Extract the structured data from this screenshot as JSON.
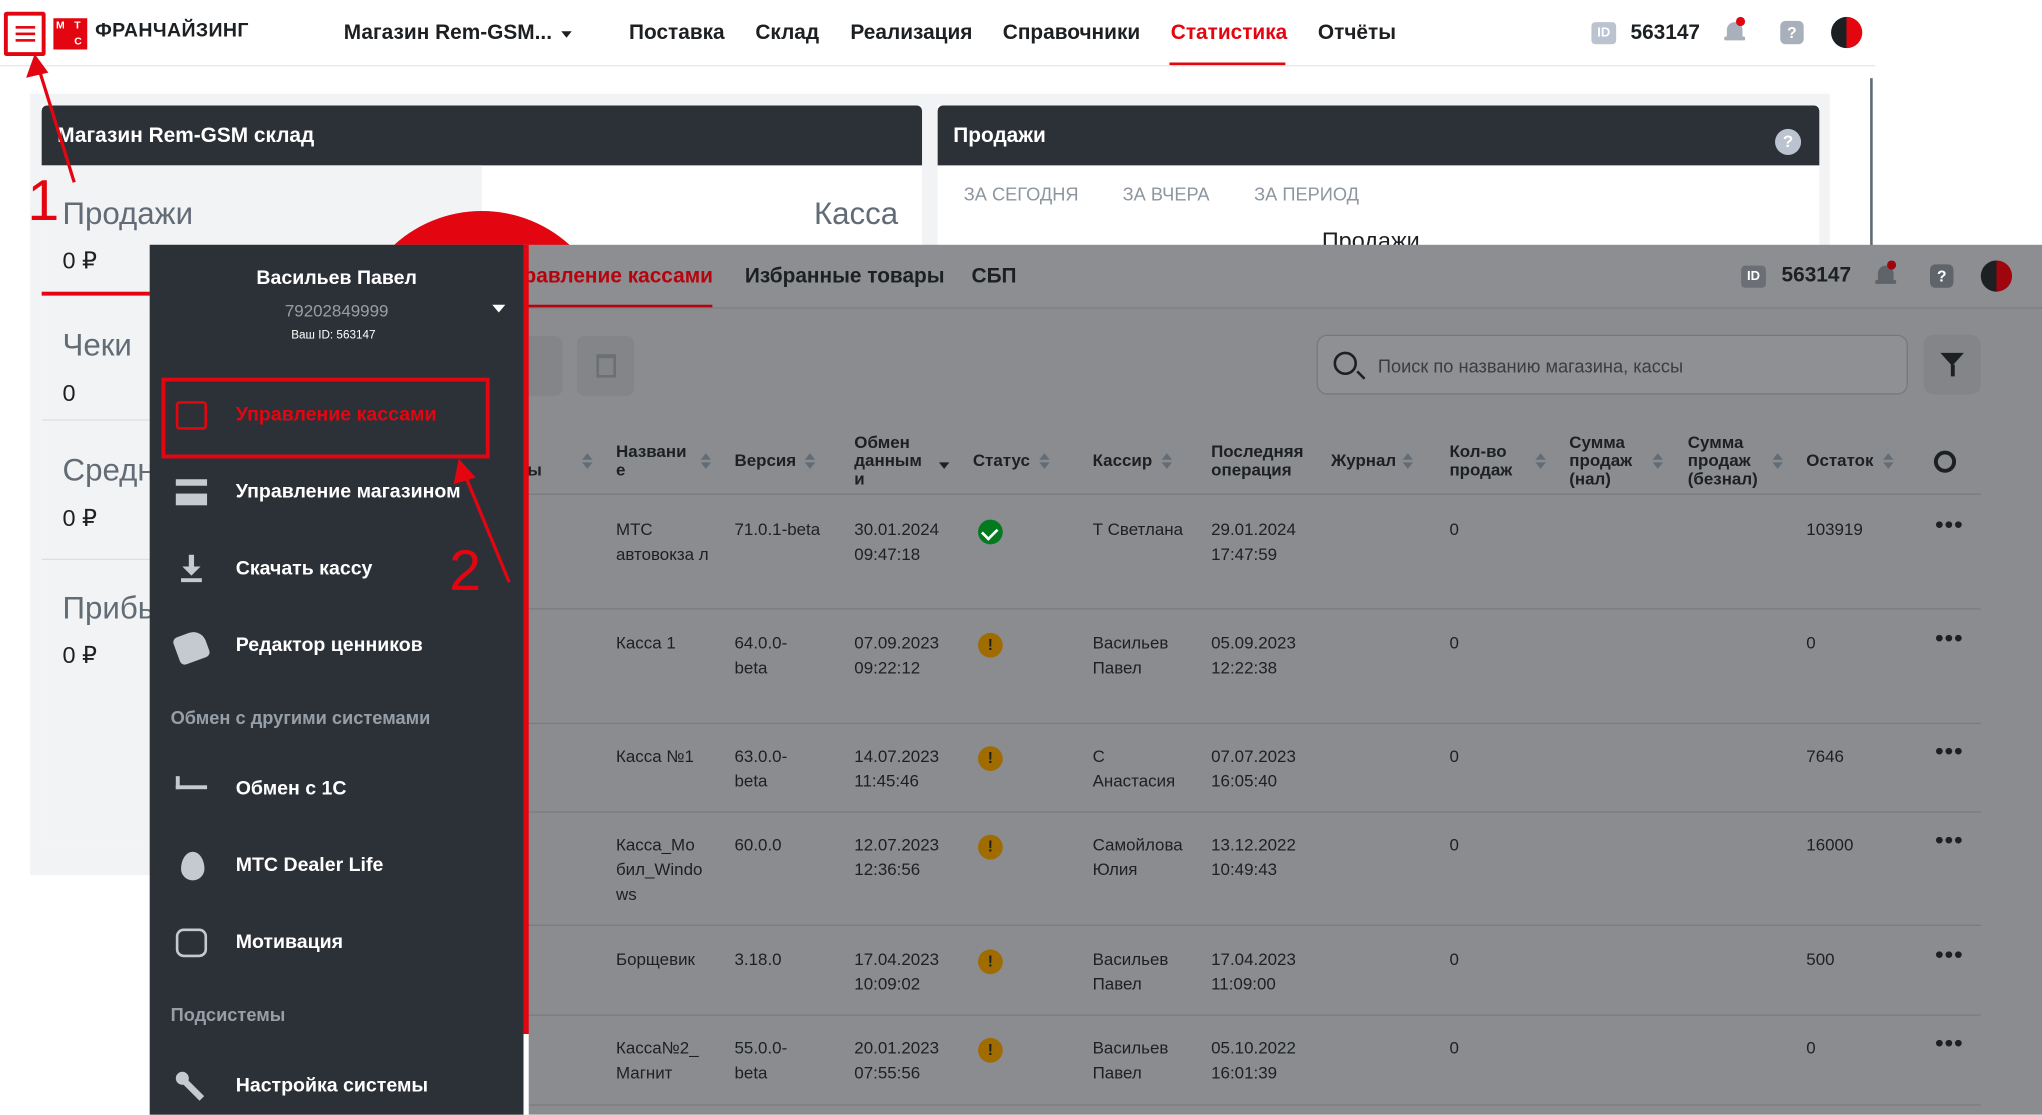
{
  "topbar": {
    "logo_letters": [
      "М",
      "Т",
      "С"
    ],
    "brand": "ФРАНЧАЙЗИНГ",
    "store": "Магазин Rem-GSM...",
    "nav": [
      "Поставка",
      "Склад",
      "Реализация",
      "Справочники",
      "Статистика",
      "Отчёты"
    ],
    "active_nav": "Статистика",
    "id_badge": "ID",
    "user_id": "563147"
  },
  "dashboard": {
    "store_card_title": "Магазин Rem-GSM склад",
    "stats": [
      {
        "label": "Продажи",
        "value": "0 ₽"
      },
      {
        "label": "Чеки",
        "value": "0"
      },
      {
        "label": "Средн",
        "value": "0 ₽"
      },
      {
        "label": "Прибь",
        "value": "0 ₽"
      }
    ],
    "kassa_label": "Касса",
    "sales_card_title": "Продажи",
    "help_glyph": "?",
    "periods": [
      "ЗА СЕГОДНЯ",
      "ЗА ВЧЕРА",
      "ЗА ПЕРИОД"
    ],
    "sales_subtitle": "Продажи"
  },
  "cashbox_window": {
    "tabs": [
      "равление кассами",
      "Избранные товары",
      "СБП"
    ],
    "active_tab": "равление кассами",
    "id_badge": "ID",
    "user_id": "563147",
    "search_placeholder": "Поиск по названию магазина, кассы",
    "columns": {
      "c0": "ы",
      "name": "Названи е",
      "version": "Версия",
      "exchange": "Обмен данным и",
      "status": "Статус",
      "cashier": "Кассир",
      "last_op": "Последняя операция",
      "journal": "Журнал",
      "sales_count": "Кол-во продаж",
      "sum_cash": "Сумма продаж (нал)",
      "sum_noncash": "Сумма продаж (безнал)",
      "balance": "Остаток"
    },
    "rows": [
      {
        "name": "МТС автовокза л",
        "version": "71.0.1-beta",
        "exchange": "30.01.2024 09:47:18",
        "status": "ok",
        "cashier": "Т Светлана",
        "last_op": "29.01.2024 17:47:59",
        "sales_count": "0",
        "balance": "103919"
      },
      {
        "name": "Касса 1",
        "version": "64.0.0- beta",
        "exchange": "07.09.2023 09:22:12",
        "status": "warn",
        "cashier": "Васильев Павел",
        "last_op": "05.09.2023 12:22:38",
        "sales_count": "0",
        "balance": "0"
      },
      {
        "name": "Касса №1",
        "version": "63.0.0- beta",
        "exchange": "14.07.2023 11:45:46",
        "status": "warn",
        "cashier": "С Анастасия",
        "last_op": "07.07.2023 16:05:40",
        "sales_count": "0",
        "balance": "7646"
      },
      {
        "name": "Касса_Мо бил_Windo ws",
        "version": "60.0.0",
        "exchange": "12.07.2023 12:36:56",
        "status": "warn",
        "cashier": "Самойлова Юлия",
        "last_op": "13.12.2022 10:49:43",
        "sales_count": "0",
        "balance": "16000"
      },
      {
        "name": "Борщевик",
        "version": "3.18.0",
        "exchange": "17.04.2023 10:09:02",
        "status": "warn",
        "cashier": "Васильев Павел",
        "last_op": "17.04.2023 11:09:00",
        "sales_count": "0",
        "balance": "500"
      },
      {
        "name": "Касса№2_ Магнит",
        "version": "55.0.0- beta",
        "exchange": "20.01.2023 07:55:56",
        "status": "warn",
        "cashier": "Васильев Павел",
        "last_op": "05.10.2022 16:01:39",
        "sales_count": "0",
        "balance": "0"
      }
    ],
    "warn_glyph": "!",
    "more_glyph": "•••"
  },
  "sidebar": {
    "user_name": "Васильев Павел",
    "phone": "79202849999",
    "your_id": "Ваш ID: 563147",
    "items": [
      {
        "label": "Управление кассами",
        "icon": "cash-register-icon",
        "active": true
      },
      {
        "label": "Управление магазином",
        "icon": "store-icon"
      },
      {
        "label": "Скачать кассу",
        "icon": "download-icon"
      },
      {
        "label": "Редактор ценников",
        "icon": "price-tag-icon"
      }
    ],
    "section_exchange": "Обмен с другими системами",
    "exchange_items": [
      {
        "label": "Обмен с 1С",
        "icon": "1c-icon"
      },
      {
        "label": "МТС Dealer Life",
        "icon": "egg-icon"
      },
      {
        "label": "Мотивация",
        "icon": "motivation-icon"
      }
    ],
    "section_subsystems": "Подсистемы",
    "subsystem_items": [
      {
        "label": "Настройка системы",
        "icon": "wrench-icon"
      }
    ]
  },
  "annotations": {
    "step1": "1",
    "step2": "2"
  },
  "colors": {
    "accent": "#e30611",
    "sidebar": "#2c3138",
    "header": "#2c3138"
  }
}
